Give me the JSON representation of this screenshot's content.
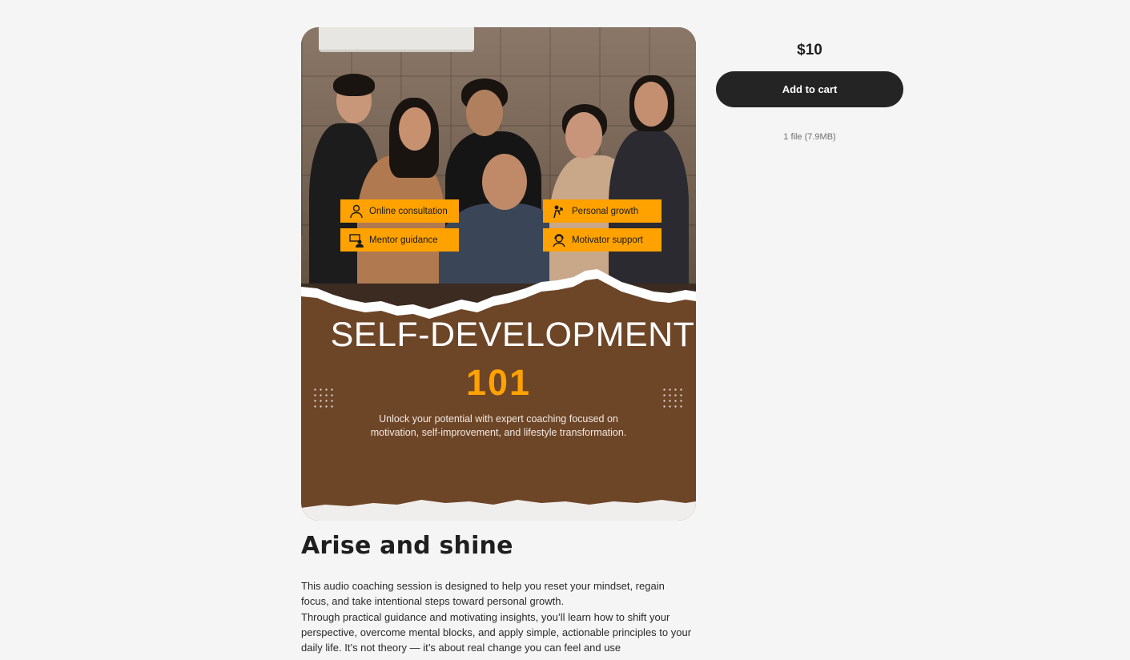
{
  "product": {
    "price": "$10",
    "add_to_cart_label": "Add to cart",
    "file_info": "1 file (7.9MB)",
    "title": "Arise and shine",
    "description": [
      "This audio coaching session is designed to help you reset your mindset, regain focus, and take intentional steps toward personal growth.",
      "Through practical guidance and motivating insights, you’ll learn how to shift your perspective, overcome mental blocks, and apply simple, actionable principles to your daily life. It’s not theory — it’s about real change you can feel and use"
    ]
  },
  "cover": {
    "headline": "SELF-DEVELOPMENT",
    "headline_number": "101",
    "tagline_line1": "Unlock your potential with expert coaching focused on",
    "tagline_line2": "motivation, self-improvement, and lifestyle transformation.",
    "badges": [
      {
        "label": "Online consultation",
        "icon": "consultant-icon"
      },
      {
        "label": "Mentor guidance",
        "icon": "presentation-icon"
      },
      {
        "label": "Personal growth",
        "icon": "growth-icon"
      },
      {
        "label": "Motivator support",
        "icon": "support-icon"
      }
    ],
    "colors": {
      "accent": "#ffa200",
      "cover_brown": "#6d4527",
      "button_dark": "#242424",
      "page_bg": "#f5f5f5"
    }
  }
}
